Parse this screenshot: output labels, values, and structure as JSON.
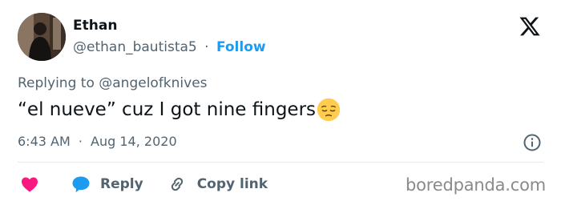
{
  "author": {
    "name": "Ethan",
    "handle": "@ethan_bautista5",
    "separator": "·",
    "follow_label": "Follow"
  },
  "brand_icon": "x-logo-icon",
  "reply_context": {
    "prefix": "Replying to",
    "mention": "@angelofknives"
  },
  "tweet": {
    "text": "“el nueve” cuz I got nine fingers",
    "emoji_icon": "pensive-face-emoji"
  },
  "meta": {
    "time": "6:43 AM",
    "separator": "·",
    "date": "Aug 14, 2020"
  },
  "actions": {
    "like_icon": "heart-icon",
    "reply_label": "Reply",
    "copy_link_label": "Copy link"
  },
  "watermark": "boredpanda.com",
  "colors": {
    "text": "#0f1419",
    "muted": "#536471",
    "accent": "#1d9bf0",
    "heart": "#f91880",
    "reply_bubble": "#1d9bf0",
    "divider": "#e6ecf0",
    "watermark": "#8a8a8a"
  }
}
